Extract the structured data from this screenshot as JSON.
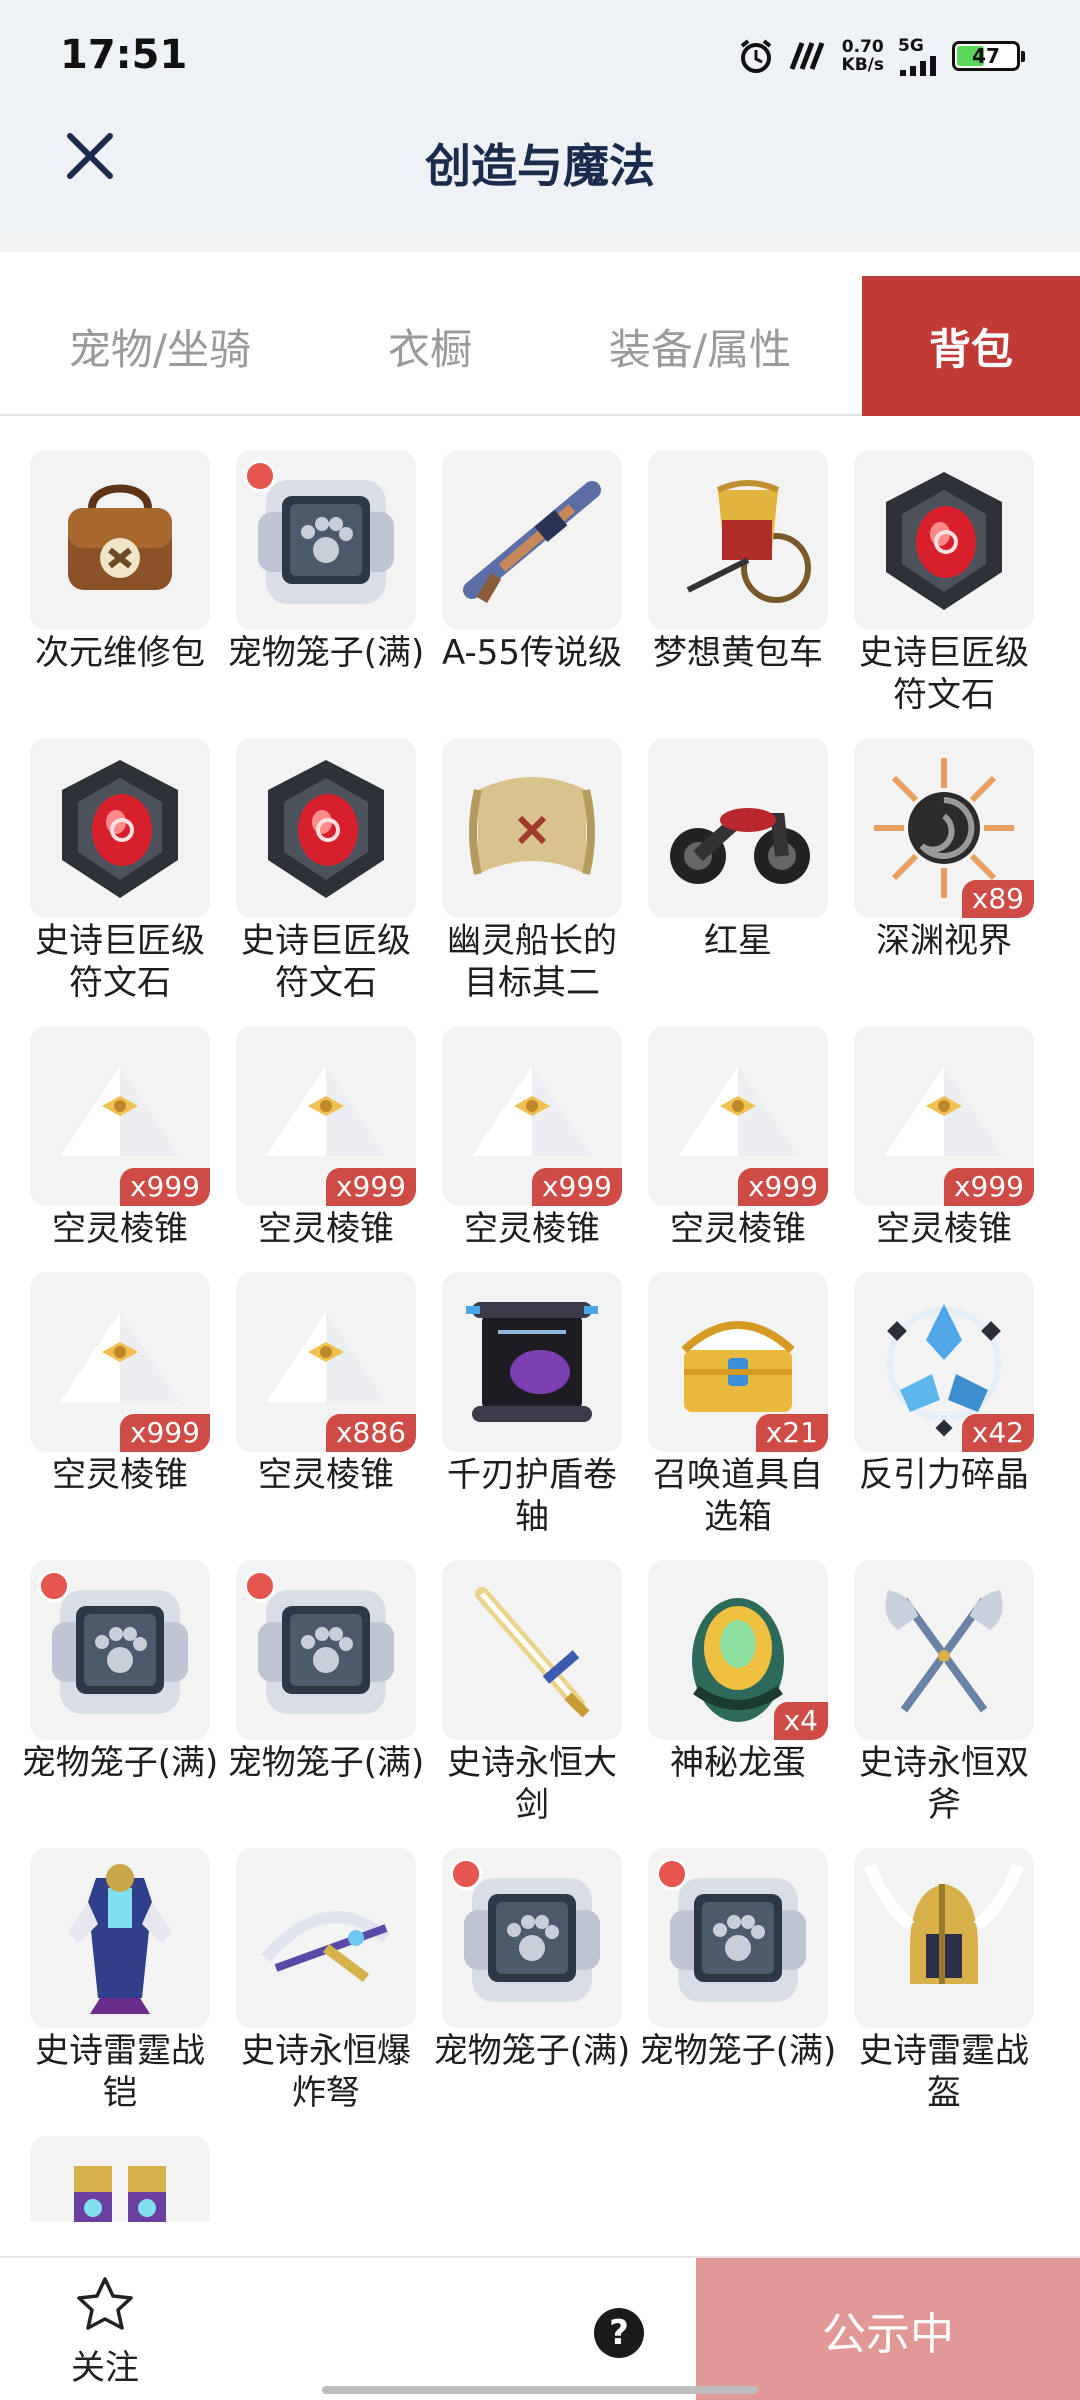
{
  "status_bar": {
    "time": "17:51",
    "speed_value": "0.70",
    "speed_unit": "KB/s",
    "network": "5G",
    "battery": "47"
  },
  "header": {
    "title": "创造与魔法"
  },
  "tabs": [
    {
      "label": "宠物/坐骑"
    },
    {
      "label": "衣橱"
    },
    {
      "label": "装备/属性"
    },
    {
      "label": "背包",
      "active": true
    }
  ],
  "items": [
    {
      "name": "次元维修包",
      "icon": "repair-bag-icon",
      "count": ""
    },
    {
      "name": "宠物笼子(满)",
      "icon": "pet-cage-icon",
      "count": ""
    },
    {
      "name": "A-55传说级",
      "icon": "rifle-icon",
      "count": ""
    },
    {
      "name": "梦想黄包车",
      "icon": "rickshaw-icon",
      "count": ""
    },
    {
      "name": "史诗巨匠级符文石",
      "icon": "rune-stone-icon",
      "count": ""
    },
    {
      "name": "史诗巨匠级符文石",
      "icon": "rune-stone-icon",
      "count": ""
    },
    {
      "name": "史诗巨匠级符文石",
      "icon": "rune-stone-icon",
      "count": ""
    },
    {
      "name": "幽灵船长的目标其二",
      "icon": "treasure-map-icon",
      "count": ""
    },
    {
      "name": "红星",
      "icon": "motorcycle-icon",
      "count": ""
    },
    {
      "name": "深渊视界",
      "icon": "abyss-sun-icon",
      "count": "x89"
    },
    {
      "name": "空灵棱锥",
      "icon": "pyramid-icon",
      "count": "x999"
    },
    {
      "name": "空灵棱锥",
      "icon": "pyramid-icon",
      "count": "x999"
    },
    {
      "name": "空灵棱锥",
      "icon": "pyramid-icon",
      "count": "x999"
    },
    {
      "name": "空灵棱锥",
      "icon": "pyramid-icon",
      "count": "x999"
    },
    {
      "name": "空灵棱锥",
      "icon": "pyramid-icon",
      "count": "x999"
    },
    {
      "name": "空灵棱锥",
      "icon": "pyramid-icon",
      "count": "x999"
    },
    {
      "name": "空灵棱锥",
      "icon": "pyramid-icon",
      "count": "x886"
    },
    {
      "name": "千刃护盾卷轴",
      "icon": "scroll-icon",
      "count": ""
    },
    {
      "name": "召唤道具自选箱",
      "icon": "treasure-chest-icon",
      "count": "x21"
    },
    {
      "name": "反引力碎晶",
      "icon": "crystal-icon",
      "count": "x42"
    },
    {
      "name": "宠物笼子(满)",
      "icon": "pet-cage-icon",
      "count": ""
    },
    {
      "name": "宠物笼子(满)",
      "icon": "pet-cage-icon",
      "count": ""
    },
    {
      "name": "史诗永恒大剑",
      "icon": "greatsword-icon",
      "count": ""
    },
    {
      "name": "神秘龙蛋",
      "icon": "dragon-egg-icon",
      "count": "x4"
    },
    {
      "name": "史诗永恒双斧",
      "icon": "double-axe-icon",
      "count": ""
    },
    {
      "name": "史诗雷霆战铠",
      "icon": "armor-icon",
      "count": ""
    },
    {
      "name": "史诗永恒爆炸弩",
      "icon": "crossbow-icon",
      "count": ""
    },
    {
      "name": "宠物笼子(满)",
      "icon": "pet-cage-icon",
      "count": ""
    },
    {
      "name": "宠物笼子(满)",
      "icon": "pet-cage-icon",
      "count": ""
    },
    {
      "name": "史诗雷霆战盔",
      "icon": "helmet-icon",
      "count": ""
    },
    {
      "name": "",
      "icon": "boots-icon",
      "count": ""
    }
  ],
  "bottom_bar": {
    "follow_label": "关注",
    "help_label": "?",
    "publish_label": "公示中"
  },
  "colors": {
    "accent": "#c23a36",
    "publish": "#e29895",
    "badge": "#cf4b45"
  }
}
